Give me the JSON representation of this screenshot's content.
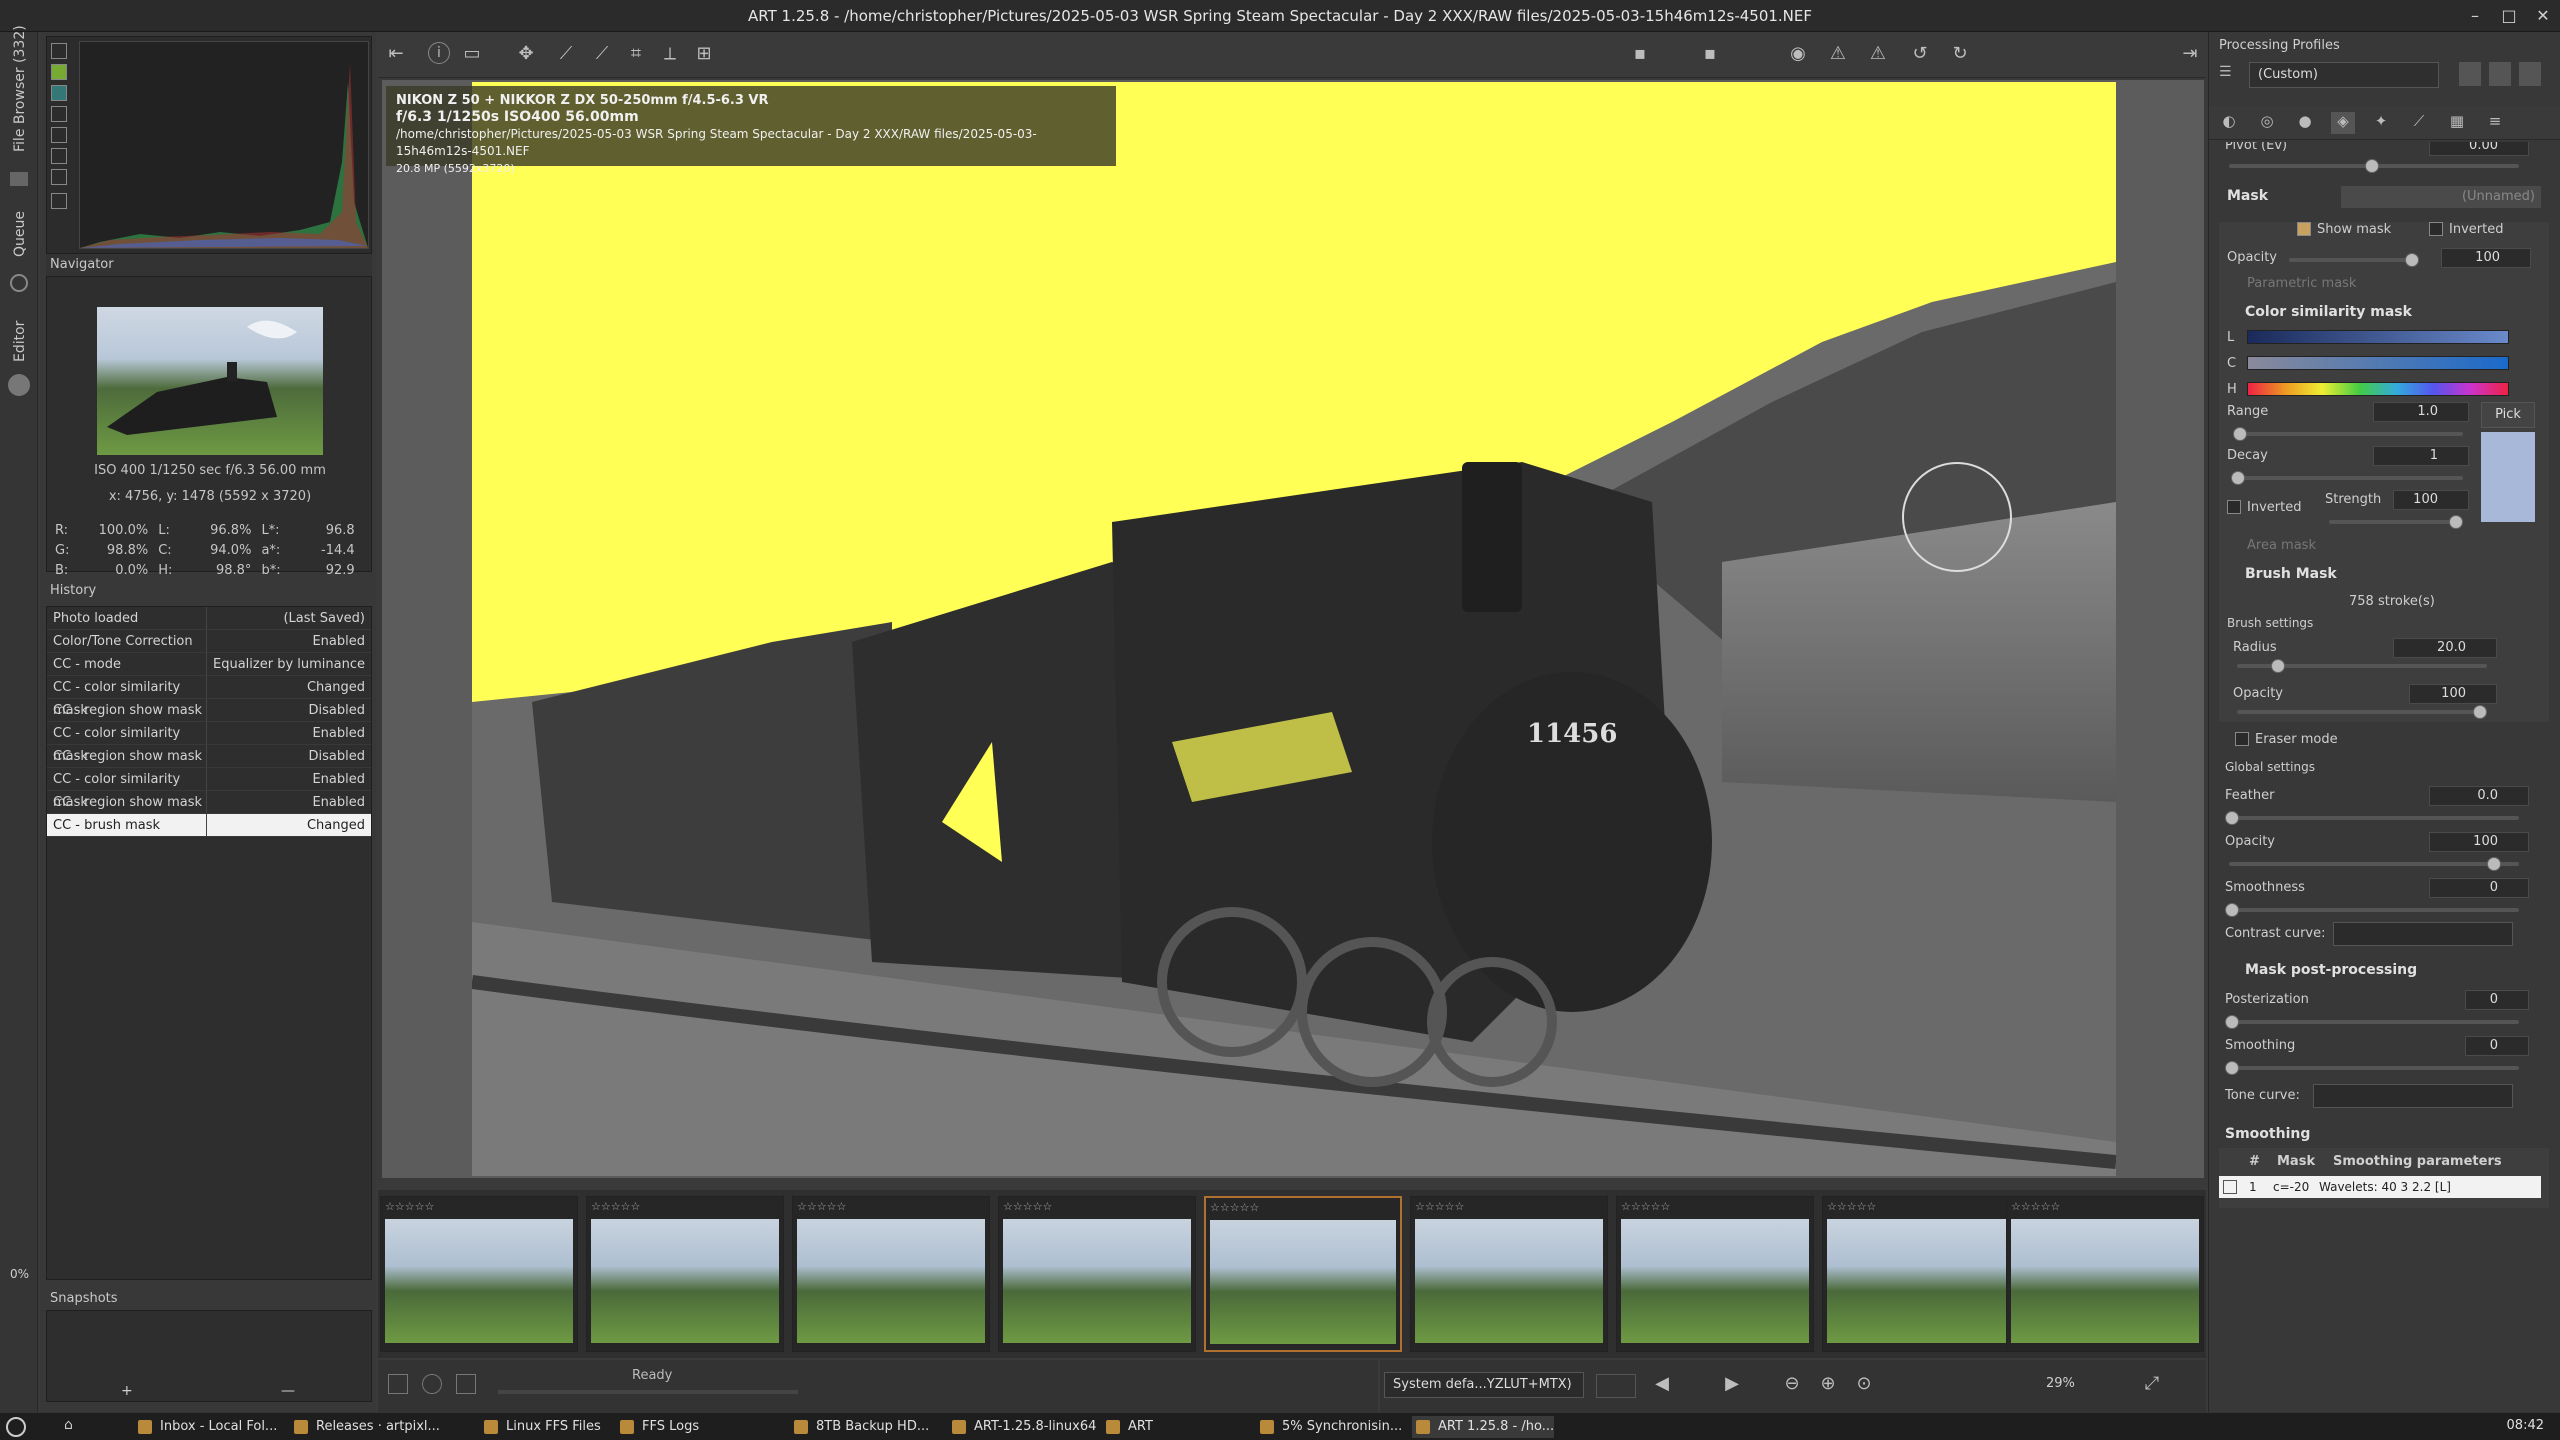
{
  "window": {
    "title": "ART 1.25.8 - /home/christopher/Pictures/2025-05-03 WSR Spring Steam Spectacular - Day 2 XXX/RAW files/2025-05-03-15h46m12s-4501.NEF",
    "min": "–",
    "max": "□",
    "close": "✕"
  },
  "vtabs": {
    "file_browser": "File Browser (332)",
    "queue": "Queue",
    "editor": "Editor",
    "zoom": "0%"
  },
  "navigator": {
    "title": "Navigator",
    "exif": "ISO 400  1/1250 sec  f/6.3  56.00 mm",
    "coords": "x: 4756, y: 1478  (5592 x 3720)",
    "rows": [
      [
        "R:",
        "100.0%",
        "L:",
        "96.8%",
        "L*:",
        "96.8"
      ],
      [
        "G:",
        "98.8%",
        "C:",
        "94.0%",
        "a*:",
        "-14.4"
      ],
      [
        "B:",
        "0.0%",
        "H:",
        "98.8°",
        "b*:",
        "92.9"
      ]
    ]
  },
  "history": {
    "title": "History",
    "items": [
      {
        "action": "Photo loaded",
        "value": "(Last Saved)"
      },
      {
        "action": "Color/Tone Correction",
        "value": "Enabled"
      },
      {
        "action": "CC - mode",
        "value": "Equalizer by luminance"
      },
      {
        "action": "CC - color similarity mask",
        "value": "Changed"
      },
      {
        "action": "CC - region show mask",
        "value": "Disabled"
      },
      {
        "action": "CC - color similarity mask",
        "value": "Enabled"
      },
      {
        "action": "CC - region show mask",
        "value": "Disabled"
      },
      {
        "action": "CC - color similarity mask",
        "value": "Enabled"
      },
      {
        "action": "CC - region show mask",
        "value": "Enabled"
      },
      {
        "action": "CC - brush mask",
        "value": "Changed"
      }
    ]
  },
  "snapshots": {
    "title": "Snapshots",
    "add": "+",
    "remove": "—"
  },
  "photo_info": {
    "line1": "NIKON Z 50 + NIKKOR Z DX 50-250mm f/4.5-6.3 VR",
    "line2": "f/6.3  1/1250s  ISO400  56.00mm",
    "line3": "/home/christopher/Pictures/2025-05-03 WSR Spring Steam Spectacular - Day 2 XXX/RAW files/2025-05-03-15h46m12s-4501.NEF",
    "line4": "20.8 MP (5592x3720)"
  },
  "loco_number": "11456",
  "status": {
    "ready": "Ready",
    "profile": "System defa...YZLUT+MTX)",
    "zoom": "29%"
  },
  "processing": {
    "title": "Processing Profiles",
    "profile": "(Custom)",
    "pivot_label": "Pivot (Ev)",
    "pivot_value": "0.00",
    "mask_title": "Mask",
    "mask_name": "(Unnamed)",
    "show_mask": "Show mask",
    "inverted": "Inverted",
    "opacity_label": "Opacity",
    "opacity_value": "100",
    "parametric_mask": "Parametric mask",
    "color_sim_title": "Color similarity mask",
    "L": "L",
    "C": "C",
    "H": "H",
    "range_label": "Range",
    "range_value": "1.0",
    "pick": "Pick",
    "decay_label": "Decay",
    "decay_value": "1",
    "inverted2": "Inverted",
    "strength_label": "Strength",
    "strength_value": "100",
    "area_mask": "Area mask",
    "brush_title": "Brush Mask",
    "strokes": "758 stroke(s)",
    "brush_settings": "Brush settings",
    "radius_label": "Radius",
    "radius_value": "20.0",
    "b_opacity_label": "Opacity",
    "b_opacity_value": "100",
    "eraser": "Eraser mode",
    "global_settings": "Global settings",
    "feather_label": "Feather",
    "feather_value": "0.0",
    "g_opacity_label": "Opacity",
    "g_opacity_value": "100",
    "smoothness_label": "Smoothness",
    "smoothness_value": "0",
    "contrast_label": "Contrast curve:",
    "postproc_title": "Mask post-processing",
    "posterization_label": "Posterization",
    "posterization_value": "0",
    "smoothing_label": "Smoothing",
    "smoothing_value": "0",
    "tone_curve_label": "Tone curve:",
    "smoothing_title": "Smoothing",
    "table_cols": [
      "#",
      "Mask",
      "Smoothing parameters"
    ],
    "table_row": [
      "1",
      "c=-20",
      "Wavelets: 40 3 2.2 [L]"
    ]
  },
  "taskbar": {
    "items": [
      "Inbox - Local Fol...",
      "Releases · artpixl...",
      "Linux FFS Files",
      "FFS Logs",
      "8TB Backup HD...",
      "ART-1.25.8-linux64",
      "ART",
      "5% Synchronisin...",
      "ART 1.25.8 - /ho..."
    ],
    "clock": "08:42"
  },
  "colors": {
    "mask_yellow": "#ffff55",
    "accent": "#b07030"
  }
}
